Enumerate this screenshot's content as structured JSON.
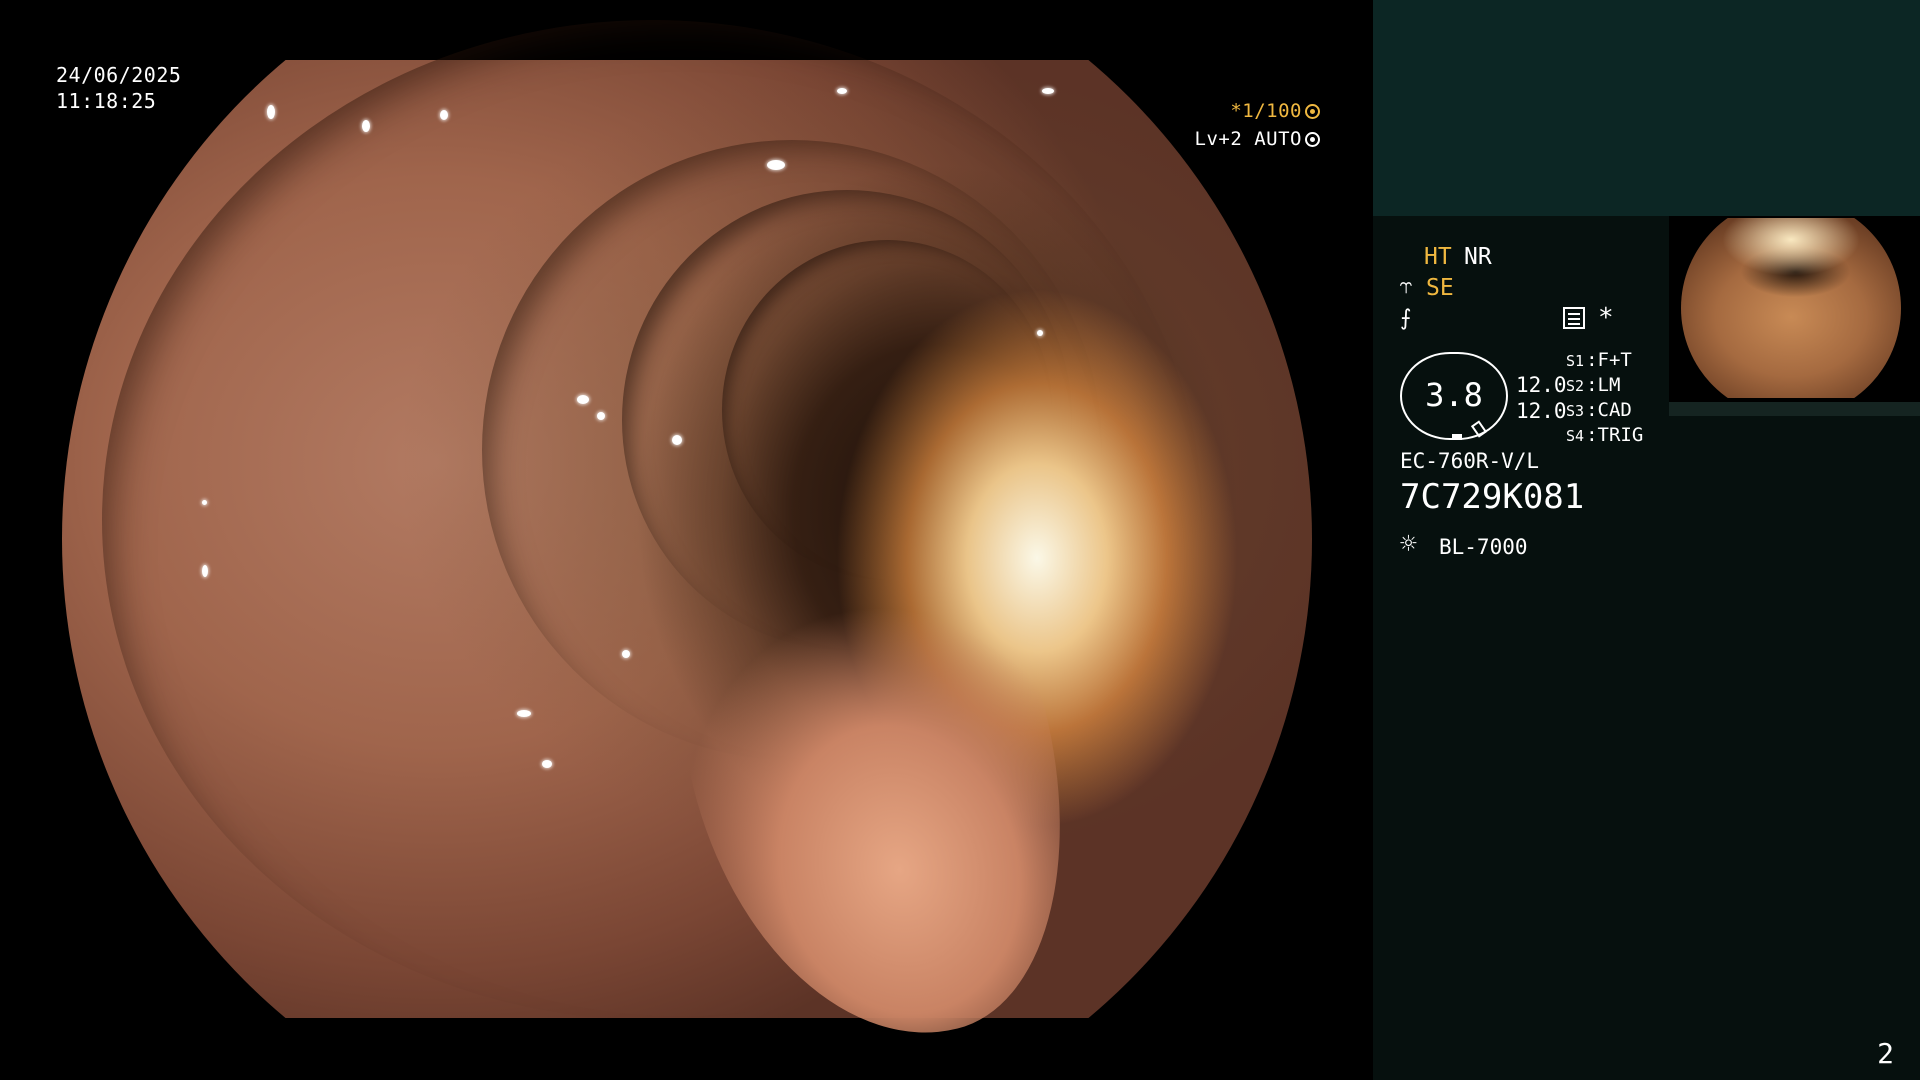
{
  "viewer": {
    "date": "24/06/2025",
    "time": "11:18:25",
    "shutter": "*1/100",
    "level": "Lv+2 AUTO"
  },
  "panel": {
    "ht": "HT",
    "nr": "NR",
    "se_icon": "scope-icon",
    "se": "SE",
    "enhance_icon": "enhance-icon",
    "menu_icon": "menu-icon",
    "star": "*",
    "zoom": "3.8",
    "value1": "12.0",
    "value2": "12.0",
    "switches": [
      {
        "key": "S1",
        "value": "F+T"
      },
      {
        "key": "S2",
        "value": "LM"
      },
      {
        "key": "S3",
        "value": "CAD"
      },
      {
        "key": "S4",
        "value": "TRIG"
      }
    ],
    "model": "EC-760R-V/L",
    "serial": "7C729K081",
    "light_icon": "light-source-icon",
    "light": "BL-7000",
    "page": "2"
  },
  "colors": {
    "accent": "#f0b840",
    "panel_bg": "#06100e",
    "panel_top_bg": "#0c2624"
  }
}
